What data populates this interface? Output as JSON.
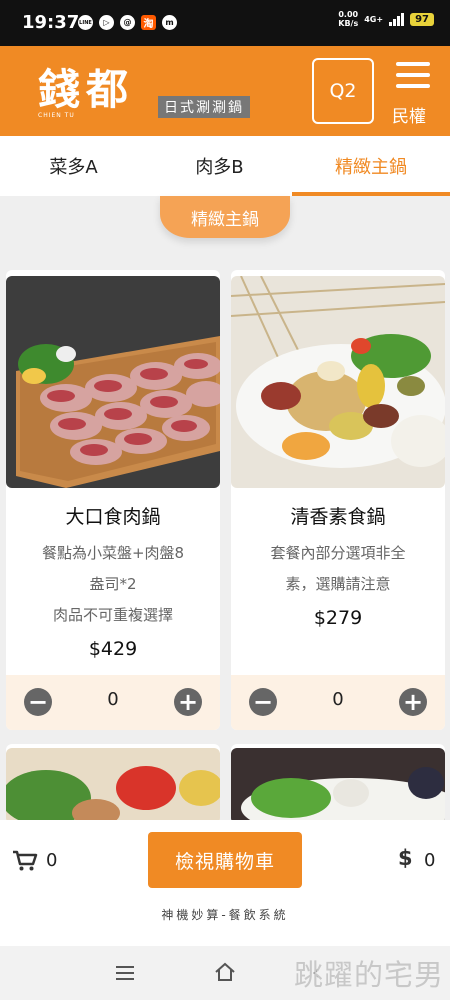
{
  "status_bar": {
    "time": "19:37",
    "app_icons": [
      "LINE",
      "▷",
      "@",
      "淘",
      "m"
    ],
    "net_speed_value": "0.00",
    "net_speed_unit": "KB/s",
    "network": "4G+",
    "battery": "97"
  },
  "header": {
    "logo_text": "錢都",
    "logo_sub": "CHIEN TU",
    "logo_tagline": "日式涮涮鍋",
    "table_number": "Q2",
    "branch_label": "民權",
    "brand_color": "#f08a24"
  },
  "tabs": [
    {
      "label": "菜多A",
      "active": false
    },
    {
      "label": "肉多B",
      "active": false
    },
    {
      "label": "精緻主鍋",
      "active": true
    }
  ],
  "section_title": "精緻主鍋",
  "products": [
    {
      "name": "大口食肉鍋",
      "description": [
        "餐點為小菜盤+肉盤8",
        "盎司*2",
        "肉品不可重複選擇"
      ],
      "price": "$429",
      "quantity": "0"
    },
    {
      "name": "清香素食鍋",
      "description": [
        "套餐內部分選項非全",
        "素，選購請注意"
      ],
      "price": "$279",
      "quantity": "0"
    }
  ],
  "qty_controls": {
    "minus": "−",
    "plus": "+"
  },
  "cart": {
    "item_count": "0",
    "view_cart_label": "檢視購物車",
    "currency_symbol": "$",
    "total": "0"
  },
  "footer_text": "神機妙算-餐飲系統",
  "watermark": "跳躍的宅男"
}
